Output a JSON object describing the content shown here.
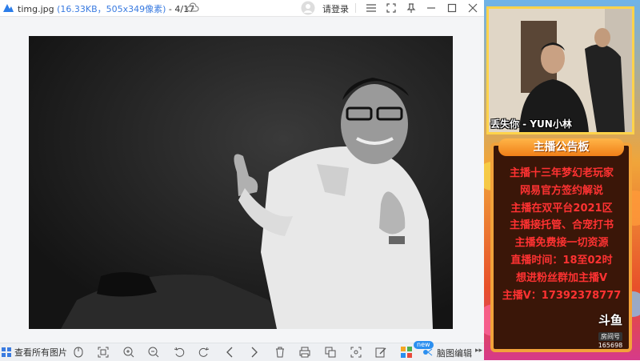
{
  "viewer": {
    "filename": "timg.jpg",
    "meta": "(16.33KB，505x349像素)",
    "counter": " - 4/17",
    "login_label": "请登录",
    "all_pictures_label": "查看所有图片",
    "new_badge": "new",
    "brain_edit_label": "脑图编辑",
    "toolbar_icons": [
      "mouse-icon",
      "fit-screen-icon",
      "zoom-in-icon",
      "zoom-out-icon",
      "rotate-left-icon",
      "rotate-right-icon",
      "prev-icon",
      "next-icon",
      "delete-icon",
      "print-icon",
      "copy-icon",
      "crop-icon",
      "edit-icon",
      "apps-icon"
    ]
  },
  "stream": {
    "caption": "丢失你 - YUN小林",
    "board_title": "主播公告板",
    "board_lines": [
      "主播十三年梦幻老玩家",
      "网易官方签约解说",
      "主播在双平台2021区",
      "主播接托管、合宠打书",
      "主播免费接一切资源",
      "直播时间：18至02时",
      "想进粉丝群加主播V",
      "主播V：17392378777"
    ],
    "platform_logo": "斗鱼",
    "room_label": "房间号",
    "room_number": "165698"
  },
  "colors": {
    "accent_blue": "#3a7be0",
    "board_text": "#ff3232",
    "board_border": "#f2a23a"
  }
}
